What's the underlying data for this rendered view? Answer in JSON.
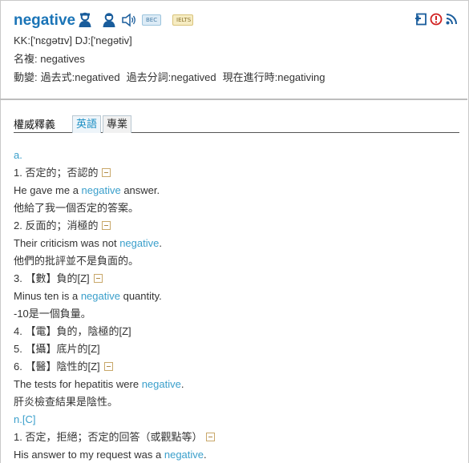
{
  "header": {
    "word": "negative",
    "bec_label": "BEC",
    "ielts_label": "IELTS",
    "pronunciation": "KK:['nɛgətɪv] DJ:['negətiv]",
    "plural": "名複: negatives",
    "verb_prefix": "動變:",
    "verb_past": "過去式:negatived",
    "verb_pp": "過去分詞:negatived",
    "verb_ing": "現在進行時:negativing"
  },
  "tabs": {
    "title": "權威釋義",
    "english": "英語",
    "professional": "專業"
  },
  "entries": [
    {
      "type": "pos",
      "text": "a."
    },
    {
      "type": "def",
      "text": "1. 否定的；否認的"
    },
    {
      "type": "ex",
      "pre": "He gave me a ",
      "hl": "negative",
      "post": " answer."
    },
    {
      "type": "tr",
      "text": "他給了我一個否定的答案。"
    },
    {
      "type": "def",
      "text": "2. 反面的；消極的"
    },
    {
      "type": "ex",
      "pre": "Their criticism was not ",
      "hl": "negative",
      "post": "."
    },
    {
      "type": "tr",
      "text": "他們的批評並不是負面的。"
    },
    {
      "type": "def",
      "text": "3. 【數】負的[Z]"
    },
    {
      "type": "ex",
      "pre": "Minus ten is a ",
      "hl": "negative",
      "post": " quantity."
    },
    {
      "type": "tr",
      "text": "-10是一個負量。"
    },
    {
      "type": "tr",
      "text": "4. 【電】負的，陰極的[Z]"
    },
    {
      "type": "tr",
      "text": "5. 【攝】底片的[Z]"
    },
    {
      "type": "def",
      "text": "6. 【醫】陰性的[Z]"
    },
    {
      "type": "ex",
      "pre": "The tests for hepatitis were ",
      "hl": "negative",
      "post": "."
    },
    {
      "type": "tr",
      "text": "肝炎檢查結果是陰性。"
    },
    {
      "type": "pos",
      "text": "n.[C]"
    },
    {
      "type": "def",
      "text": "1. 否定，拒絕；否定的回答（或觀點等）"
    },
    {
      "type": "ex",
      "pre": "His answer to my request was a ",
      "hl": "negative",
      "post": "."
    }
  ],
  "colors": {
    "word": "#1a74b7",
    "highlight": "#3a9fcb",
    "tab_active": "#1c8fc4"
  },
  "icons": [
    "person-icon",
    "person-icon",
    "speaker-icon",
    "add-wordbook-icon",
    "report-icon",
    "rss-icon"
  ]
}
